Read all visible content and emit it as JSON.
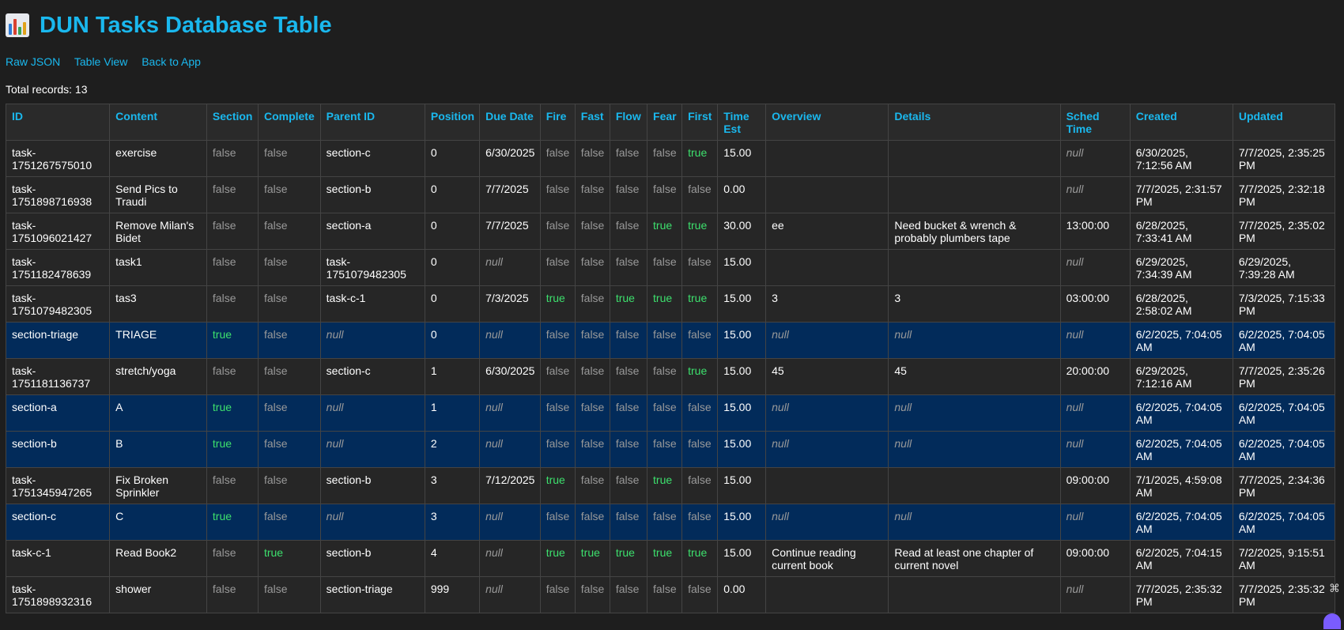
{
  "title": "DUN Tasks Database Table",
  "nav": [
    "Raw JSON",
    "Table View",
    "Back to App"
  ],
  "total": "Total records: 13",
  "columns": [
    "ID",
    "Content",
    "Section",
    "Complete",
    "Parent ID",
    "Position",
    "Due Date",
    "Fire",
    "Fast",
    "Flow",
    "Fear",
    "First",
    "Time Est",
    "Overview",
    "Details",
    "Sched Time",
    "Created",
    "Updated"
  ],
  "rows": [
    {
      "section": false,
      "cells": [
        "task-1751267575010",
        "exercise",
        "false",
        "false",
        "section-c",
        "0",
        "6/30/2025",
        "false",
        "false",
        "false",
        "false",
        "true",
        "15.00",
        "",
        "",
        "null",
        "6/30/2025, 7:12:56 AM",
        "7/7/2025, 2:35:25 PM"
      ]
    },
    {
      "section": false,
      "cells": [
        "task-1751898716938",
        "Send Pics to Traudi",
        "false",
        "false",
        "section-b",
        "0",
        "7/7/2025",
        "false",
        "false",
        "false",
        "false",
        "false",
        "0.00",
        "",
        "",
        "null",
        "7/7/2025, 2:31:57 PM",
        "7/7/2025, 2:32:18 PM"
      ]
    },
    {
      "section": false,
      "cells": [
        "task-1751096021427",
        "Remove Milan's Bidet",
        "false",
        "false",
        "section-a",
        "0",
        "7/7/2025",
        "false",
        "false",
        "false",
        "true",
        "true",
        "30.00",
        "ee",
        "Need bucket & wrench & probably plumbers tape",
        "13:00:00",
        "6/28/2025, 7:33:41 AM",
        "7/7/2025, 2:35:02 PM"
      ]
    },
    {
      "section": false,
      "cells": [
        "task-1751182478639",
        "task1",
        "false",
        "false",
        "task-1751079482305",
        "0",
        "null",
        "false",
        "false",
        "false",
        "false",
        "false",
        "15.00",
        "",
        "",
        "null",
        "6/29/2025, 7:34:39 AM",
        "6/29/2025, 7:39:28 AM"
      ]
    },
    {
      "section": false,
      "cells": [
        "task-1751079482305",
        "tas3",
        "false",
        "false",
        "task-c-1",
        "0",
        "7/3/2025",
        "true",
        "false",
        "true",
        "true",
        "true",
        "15.00",
        "3",
        "3",
        "03:00:00",
        "6/28/2025, 2:58:02 AM",
        "7/3/2025, 7:15:33 PM"
      ]
    },
    {
      "section": true,
      "cells": [
        "section-triage",
        "TRIAGE",
        "true",
        "false",
        "null",
        "0",
        "null",
        "false",
        "false",
        "false",
        "false",
        "false",
        "15.00",
        "null",
        "null",
        "null",
        "6/2/2025, 7:04:05 AM",
        "6/2/2025, 7:04:05 AM"
      ]
    },
    {
      "section": false,
      "cells": [
        "task-1751181136737",
        "stretch/yoga",
        "false",
        "false",
        "section-c",
        "1",
        "6/30/2025",
        "false",
        "false",
        "false",
        "false",
        "true",
        "15.00",
        "45",
        "45",
        "20:00:00",
        "6/29/2025, 7:12:16 AM",
        "7/7/2025, 2:35:26 PM"
      ]
    },
    {
      "section": true,
      "cells": [
        "section-a",
        "A",
        "true",
        "false",
        "null",
        "1",
        "null",
        "false",
        "false",
        "false",
        "false",
        "false",
        "15.00",
        "null",
        "null",
        "null",
        "6/2/2025, 7:04:05 AM",
        "6/2/2025, 7:04:05 AM"
      ]
    },
    {
      "section": true,
      "cells": [
        "section-b",
        "B",
        "true",
        "false",
        "null",
        "2",
        "null",
        "false",
        "false",
        "false",
        "false",
        "false",
        "15.00",
        "null",
        "null",
        "null",
        "6/2/2025, 7:04:05 AM",
        "6/2/2025, 7:04:05 AM"
      ]
    },
    {
      "section": false,
      "cells": [
        "task-1751345947265",
        "Fix Broken Sprinkler",
        "false",
        "false",
        "section-b",
        "3",
        "7/12/2025",
        "true",
        "false",
        "false",
        "true",
        "false",
        "15.00",
        "",
        "",
        "09:00:00",
        "7/1/2025, 4:59:08 AM",
        "7/7/2025, 2:34:36 PM"
      ]
    },
    {
      "section": true,
      "cells": [
        "section-c",
        "C",
        "true",
        "false",
        "null",
        "3",
        "null",
        "false",
        "false",
        "false",
        "false",
        "false",
        "15.00",
        "null",
        "null",
        "null",
        "6/2/2025, 7:04:05 AM",
        "6/2/2025, 7:04:05 AM"
      ]
    },
    {
      "section": false,
      "cells": [
        "task-c-1",
        "Read Book2",
        "false",
        "true",
        "section-b",
        "4",
        "null",
        "true",
        "true",
        "true",
        "true",
        "true",
        "15.00",
        "Continue reading current book",
        "Read at least one chapter of current novel",
        "09:00:00",
        "6/2/2025, 7:04:15 AM",
        "7/2/2025, 9:15:51 AM"
      ]
    },
    {
      "section": false,
      "cells": [
        "task-1751898932316",
        "shower",
        "false",
        "false",
        "section-triage",
        "999",
        "null",
        "false",
        "false",
        "false",
        "false",
        "false",
        "0.00",
        "",
        "",
        "null",
        "7/7/2025, 2:35:32 PM",
        "7/7/2025, 2:35:32 PM"
      ]
    }
  ],
  "colors": {
    "accent": "#1ab8ee",
    "true": "#3de06d",
    "false": "#999999",
    "section_row": "#022b5a",
    "background": "#1e1e1e"
  },
  "icons": {
    "title_icon": "bar-chart-icon",
    "corner_top": "apps-icon",
    "corner_bottom": "assistant-icon"
  }
}
